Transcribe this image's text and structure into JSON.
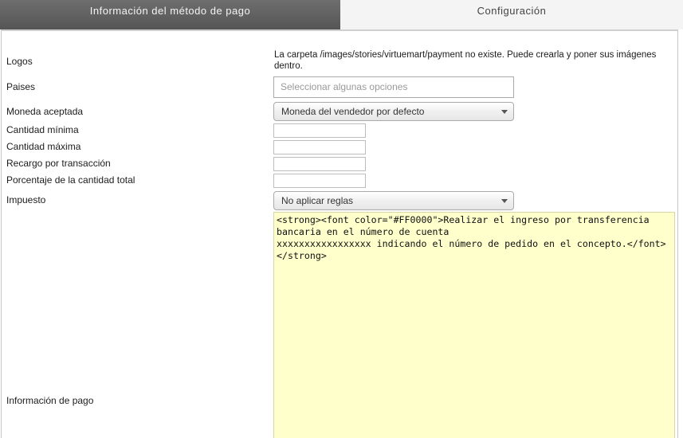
{
  "tabs": {
    "active_label": "Información del método de pago",
    "inactive_label": "Configuración"
  },
  "fields": {
    "logos": {
      "label": "Logos",
      "message": "La carpeta /images/stories/virtuemart/payment no existe. Puede crearla y poner sus imágenes dentro."
    },
    "countries": {
      "label": "Paises",
      "placeholder": "Seleccionar algunas opciones"
    },
    "currency": {
      "label": "Moneda aceptada",
      "selected": "Moneda del vendedor por defecto"
    },
    "min_amount": {
      "label": "Cantidad mínima",
      "value": ""
    },
    "max_amount": {
      "label": "Cantidad máxima",
      "value": ""
    },
    "cost_per_transaction": {
      "label": "Recargo por transacción",
      "value": ""
    },
    "cost_percent_total": {
      "label": "Porcentaje de la cantidad total",
      "value": ""
    },
    "tax": {
      "label": "Impuesto",
      "selected": "No aplicar reglas"
    },
    "payment_info": {
      "label": "Información de pago",
      "value": "<strong><font color=\"#FF0000\">Realizar el ingreso por transferencia bancaria en el número de cuenta\nxxxxxxxxxxxxxxxxx indicando el número de pedido en el concepto.</font>\n</strong>"
    }
  },
  "colors": {
    "tab_active_bg": "#5f5f5f",
    "editor_bg": "#ffffcc"
  },
  "icons": {
    "select_arrow": "chevron-down-icon"
  }
}
